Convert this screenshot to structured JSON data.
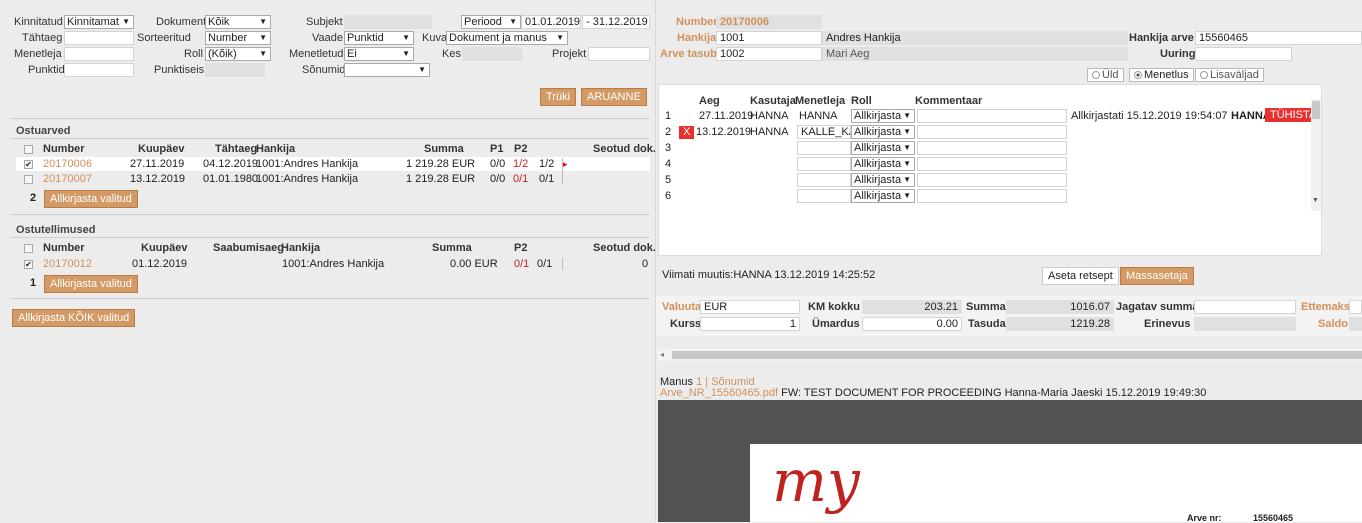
{
  "filters": {
    "kinnitatud_label": "Kinnitatud",
    "kinnitatud_value": "Kinnitamat",
    "dokument_label": "Dokument",
    "dokument_value": "Kõik",
    "subjekt_label": "Subjekt",
    "periood_value": "Periood",
    "period_from": "01.01.2019",
    "period_to": "- 31.12.2019",
    "tahtaeg_label": "Tähtaeg",
    "sorteeritud_label": "Sorteeritud",
    "sorteeritud_value": "Number",
    "vaade_label": "Vaade",
    "vaade_value": "Punktid",
    "kuva_label": "Kuva",
    "kuva_value": "Dokument ja manus",
    "menetleja_label": "Menetleja",
    "roll_label": "Roll",
    "roll_value": "(Kõik)",
    "menetletud_label": "Menetletud",
    "menetletud_value": "Ei",
    "kes_label": "Kes",
    "projekt_label": "Projekt",
    "punktid_label": "Punktid",
    "punktiseis_label": "Punktiseis",
    "sonumid_label": "Sõnumid",
    "print_button": "Trüki",
    "report_button": "ARUANNE"
  },
  "ostuarved": {
    "title": "Ostuarved",
    "headers": [
      "Number",
      "Kuupäev",
      "Tähtaeg",
      "Hankija",
      "Summa",
      "P1",
      "P2",
      "Seotud dok."
    ],
    "rows": [
      {
        "checked": "✔",
        "number": "20170006",
        "date": "27.11.2019",
        "due": "04.12.2019",
        "supplier": "1001:Andres Hankija",
        "sum": "1 219.28 EUR",
        "p1": "0/0",
        "p2a": "1/2",
        "p2b": "1/2"
      },
      {
        "checked": "",
        "number": "20170007",
        "date": "13.12.2019",
        "due": "01.01.1980",
        "supplier": "1001:Andres Hankija",
        "sum": "1 219.28 EUR",
        "p1": "0/0",
        "p2a": "0/1",
        "p2b": "0/1"
      }
    ],
    "count": "2",
    "sign_button": "Allkirjasta valitud"
  },
  "ostutellimused": {
    "title": "Ostutellimused",
    "headers": [
      "Number",
      "Kuupäev",
      "Saabumisaeg",
      "Hankija",
      "Summa",
      "P2",
      "Seotud dok."
    ],
    "rows": [
      {
        "checked": "✔",
        "number": "20170012",
        "date": "01.12.2019",
        "supplier": "1001:Andres Hankija",
        "sum": "0.00 EUR",
        "p2a": "0/1",
        "p2b": "0/1",
        "linked": "0"
      }
    ],
    "count": "1",
    "sign_button": "Allkirjasta valitud"
  },
  "sign_all_button": "Allkirjasta KÕIK valitud",
  "doc": {
    "number_label": "Number",
    "number_value": "20170006",
    "hankija_label": "Hankija",
    "hankija_code": "1001",
    "hankija_name": "Andres Hankija",
    "hankija_arve_label": "Hankija arve",
    "hankija_arve_value": "15560465",
    "arve_tasub_label": "Arve tasub",
    "arve_tasub_code": "1002",
    "arve_tasub_name": "Mari Aeg",
    "uuring_label": "Uuring"
  },
  "tabs": [
    "Üld",
    "Menetlus",
    "Lisaväljad"
  ],
  "menetlus": {
    "headers": [
      "Aeg",
      "Kasutaja",
      "Menetleja",
      "Roll",
      "Kommentaar"
    ],
    "rows": [
      {
        "n": "1",
        "time": "27.11.2019",
        "user": "HANNA",
        "handler": "HANNA",
        "role": "Allkirjasta",
        "signed": "Allkirjastati 15.12.2019 19:54:07",
        "signed_by": "HANNA",
        "cancel": "TÜHISTA"
      },
      {
        "n": "2",
        "x": "X",
        "time": "13.12.2019",
        "user": "HANNA",
        "handler": "KALLE_KAP",
        "role": "Allkirjasta"
      },
      {
        "n": "3",
        "role": "Allkirjasta"
      },
      {
        "n": "4",
        "role": "Allkirjasta"
      },
      {
        "n": "5",
        "role": "Allkirjasta"
      },
      {
        "n": "6",
        "role": "Allkirjasta"
      }
    ],
    "last_modified": "Viimati muutis:HANNA 13.12.2019 14:25:52",
    "set_recipe_button": "Aseta retsept",
    "mass_button": "Massasetaja"
  },
  "totals": {
    "valuuta_label": "Valuuta",
    "valuuta_value": "EUR",
    "km_label": "KM kokku",
    "km_value": "203.21",
    "summa_label": "Summa",
    "summa_value": "1016.07",
    "jagatav_label": "Jagatav summa",
    "ettemaks_label": "Ettemaks",
    "kurss_label": "Kurss",
    "kurss_value": "1",
    "umardus_label": "Ümardus",
    "umardus_value": "0.00",
    "tasuda_label": "Tasuda",
    "tasuda_value": "1219.28",
    "erinevus_label": "Erinevus",
    "saldo_label": "Saldo"
  },
  "attachments": {
    "manus_label": "Manus",
    "manus_count": "1",
    "sonumid_label": "| Sõnumid",
    "file_name": "Arve_NR_15560465.pdf",
    "file_desc": "FW: TEST DOCUMENT FOR PROCEEDING Hanna-Maria Jaeski 15.12.2019 19:49:30"
  },
  "preview": {
    "logo": "my",
    "arve_nr_label": "Arve nr:",
    "arve_nr_value": "15560465"
  }
}
